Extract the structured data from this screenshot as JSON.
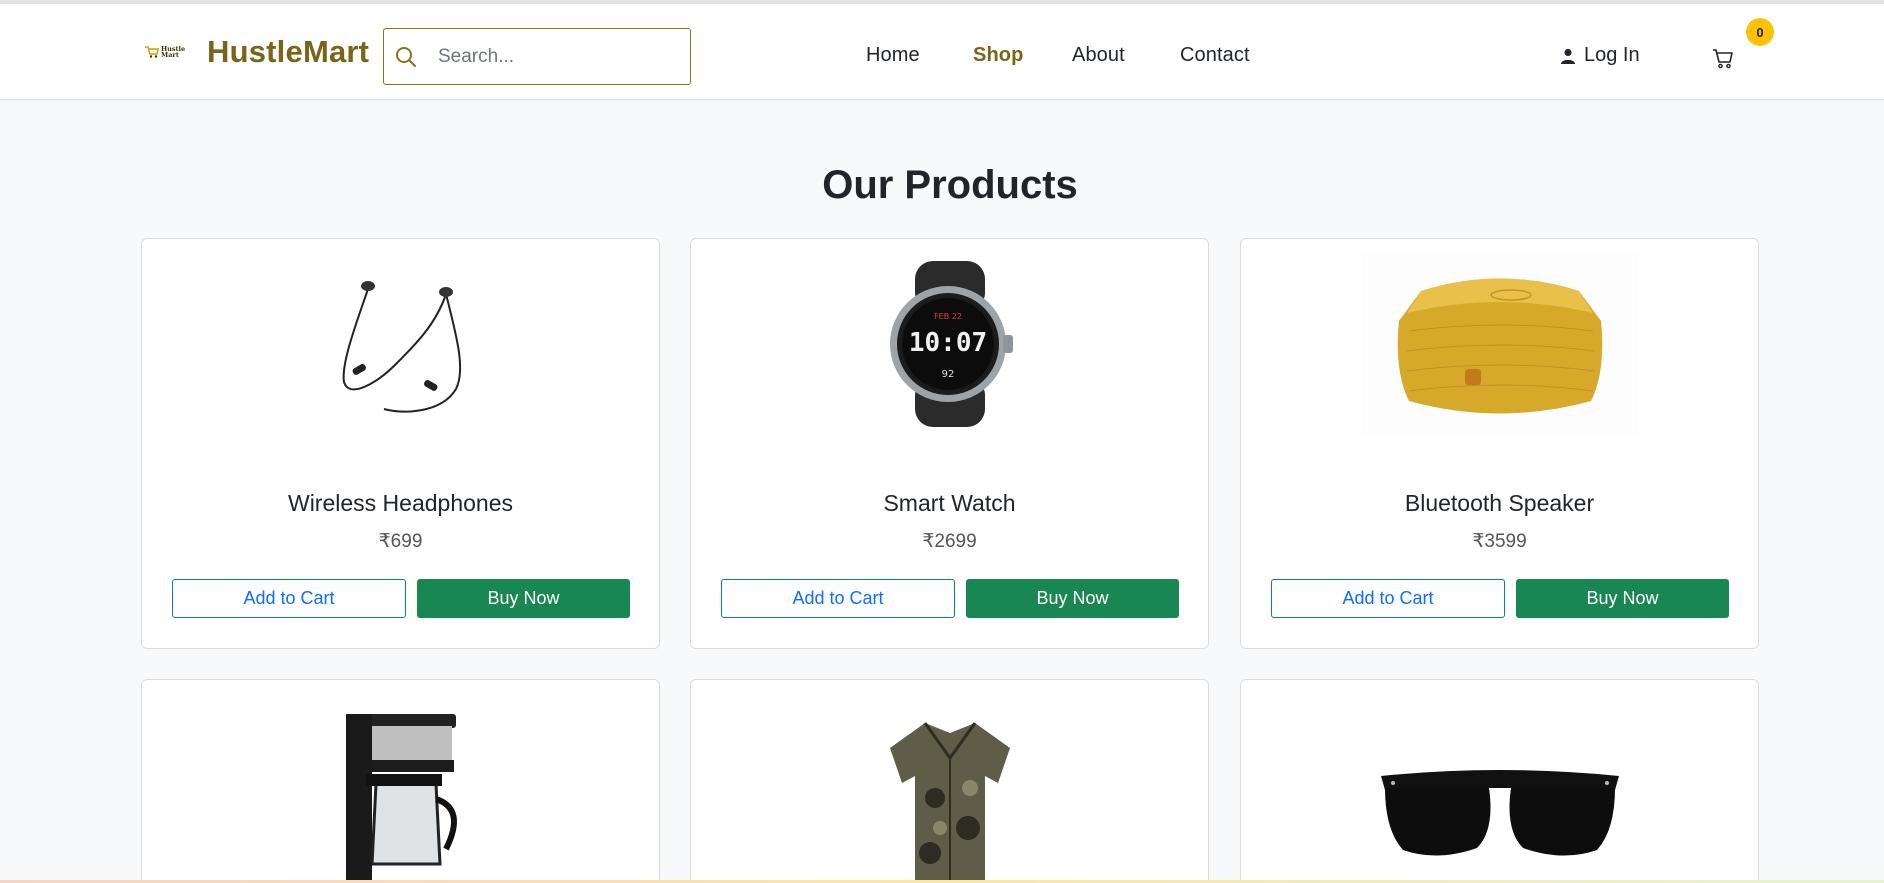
{
  "brand": {
    "logo_text_1": "Hustle",
    "logo_text_2": "Mart",
    "name": "HustleMart",
    "color": "#7a6417"
  },
  "search": {
    "placeholder": "Search...",
    "value": ""
  },
  "nav": {
    "home": "Home",
    "shop": "Shop",
    "about": "About",
    "contact": "Contact",
    "active": "Shop"
  },
  "account": {
    "login": "Log In",
    "cart_count": "0"
  },
  "main": {
    "title": "Our Products"
  },
  "products": [
    {
      "name": "Wireless Headphones",
      "price": "₹699",
      "add_label": "Add to Cart",
      "buy_label": "Buy Now",
      "image": "headphones"
    },
    {
      "name": "Smart Watch",
      "price": "₹2699",
      "add_label": "Add to Cart",
      "buy_label": "Buy Now",
      "image": "smartwatch"
    },
    {
      "name": "Bluetooth Speaker",
      "price": "₹3599",
      "add_label": "Add to Cart",
      "buy_label": "Buy Now",
      "image": "speaker"
    },
    {
      "image": "coffee-maker"
    },
    {
      "image": "shirt"
    },
    {
      "image": "sunglasses"
    }
  ],
  "colors": {
    "primary": "#0d6efd",
    "success": "#198754",
    "warning": "#ffc107",
    "background": "#f8f9fa"
  },
  "icons": {
    "search": "search-icon",
    "user": "user-icon",
    "cart": "cart-icon"
  }
}
